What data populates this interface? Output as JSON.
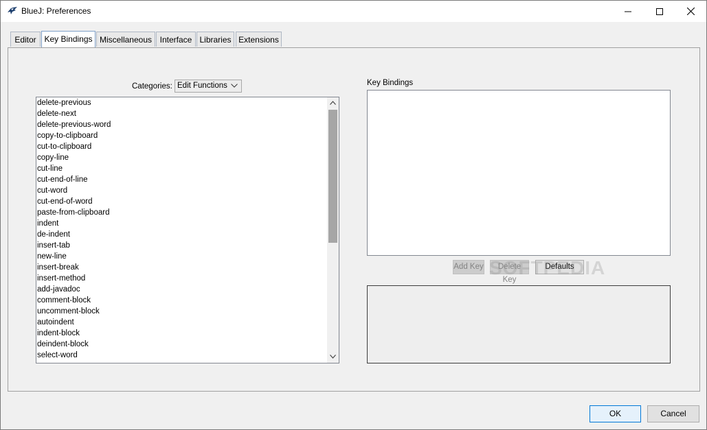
{
  "window": {
    "title": "BlueJ: Preferences",
    "controls": {
      "minimize_icon": "minimize-icon",
      "maximize_icon": "maximize-icon",
      "close_icon": "close-icon"
    }
  },
  "tabs": [
    {
      "label": "Editor",
      "active": false
    },
    {
      "label": "Key Bindings",
      "active": true
    },
    {
      "label": "Miscellaneous",
      "active": false
    },
    {
      "label": "Interface",
      "active": false
    },
    {
      "label": "Libraries",
      "active": false
    },
    {
      "label": "Extensions",
      "active": false
    }
  ],
  "categories": {
    "label": "Categories:",
    "selected": "Edit Functions"
  },
  "functions": [
    "delete-previous",
    "delete-next",
    "delete-previous-word",
    "copy-to-clipboard",
    "cut-to-clipboard",
    "copy-line",
    "cut-line",
    "cut-end-of-line",
    "cut-word",
    "cut-end-of-word",
    "paste-from-clipboard",
    "indent",
    "de-indent",
    "insert-tab",
    "new-line",
    "insert-break",
    "insert-method",
    "add-javadoc",
    "comment-block",
    "uncomment-block",
    "autoindent",
    "indent-block",
    "deindent-block",
    "select-word"
  ],
  "key_bindings": {
    "label": "Key Bindings",
    "add_key": "Add Key",
    "delete_key": "Delete Key",
    "defaults": "Defaults"
  },
  "watermark": "SOFTPEDIA",
  "footer": {
    "ok": "OK",
    "cancel": "Cancel"
  },
  "colors": {
    "ok_border": "#0078d7",
    "scroll_thumb": "#a6a6a6"
  }
}
